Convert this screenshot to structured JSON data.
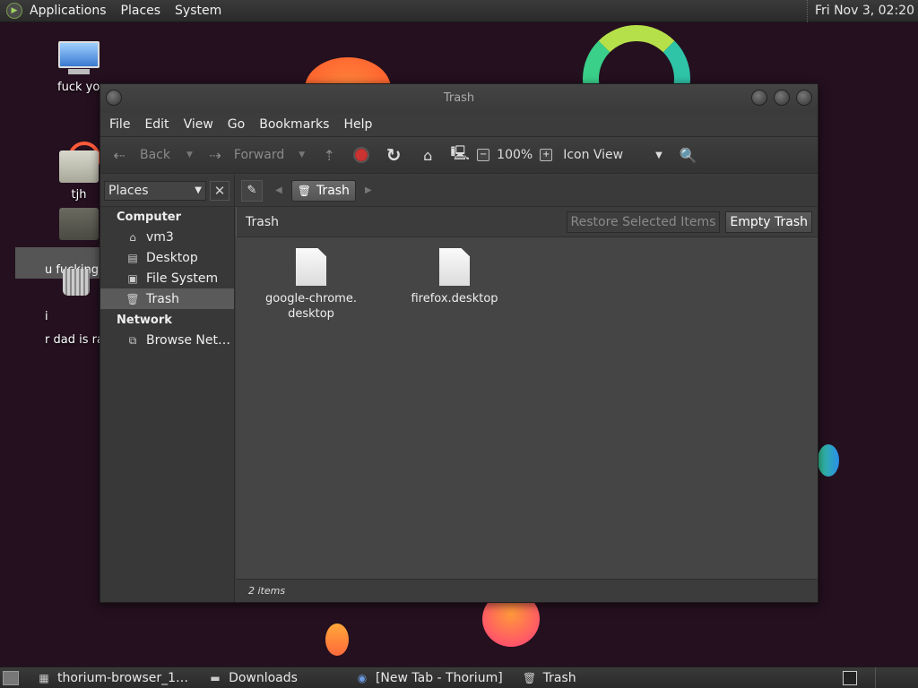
{
  "top_panel": {
    "menus": [
      "Applications",
      "Places",
      "System"
    ],
    "clock": "Fri Nov 3, 02:20"
  },
  "desktop": {
    "icons": [
      {
        "label": "fuck you",
        "icon": "computer-icon"
      },
      {
        "label": "tjh",
        "icon": "folder-icon"
      },
      {
        "label": "r dad is rap",
        "icon": "trash-icon"
      }
    ],
    "rename_text": "u fucking i"
  },
  "window": {
    "title": "Trash",
    "menu": [
      "File",
      "Edit",
      "View",
      "Go",
      "Bookmarks",
      "Help"
    ],
    "toolbar": {
      "back": "Back",
      "forward": "Forward",
      "zoom": "100%",
      "view_mode": "Icon View"
    },
    "sidebar": {
      "selector": "Places",
      "sections": [
        {
          "title": "Computer",
          "items": [
            {
              "label": "vm3",
              "icon": "home-icon"
            },
            {
              "label": "Desktop",
              "icon": "desktop-icon"
            },
            {
              "label": "File System",
              "icon": "drive-icon"
            },
            {
              "label": "Trash",
              "icon": "trash-icon",
              "selected": true
            }
          ]
        },
        {
          "title": "Network",
          "items": [
            {
              "label": "Browse Net…",
              "icon": "network-icon"
            }
          ]
        }
      ]
    },
    "path": {
      "crumb": "Trash"
    },
    "infobar": {
      "location": "Trash",
      "restore_label": "Restore Selected Items",
      "empty_label": "Empty Trash"
    },
    "files": [
      {
        "name": "google-chrome.\ndesktop"
      },
      {
        "name": "firefox.desktop"
      }
    ],
    "status": "2 items"
  },
  "taskbar": {
    "tasks": [
      {
        "label": "thorium-browser_1…",
        "icon": "package-icon"
      },
      {
        "label": "Downloads",
        "icon": "folder-icon"
      },
      {
        "label": "[New Tab - Thorium]",
        "icon": "browser-icon"
      },
      {
        "label": "Trash",
        "icon": "trash-icon"
      }
    ]
  }
}
